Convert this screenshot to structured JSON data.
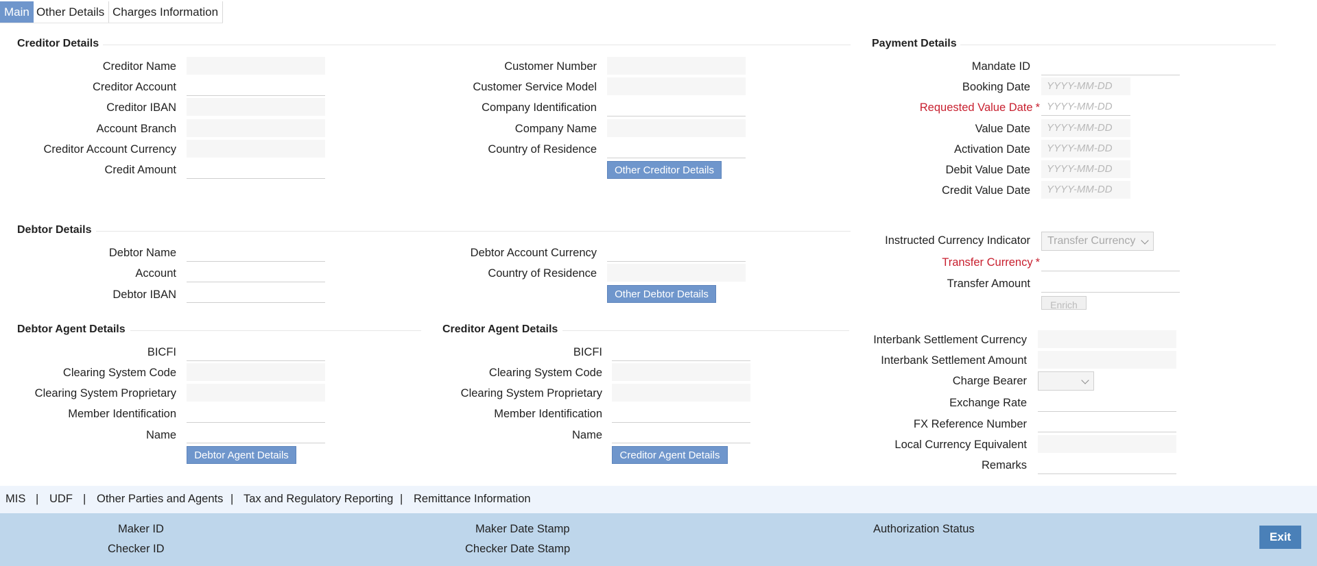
{
  "tabs": [
    "Main",
    "Other Details",
    "Charges Information"
  ],
  "creditor": {
    "title": "Creditor Details",
    "name": "Creditor Name",
    "account": "Creditor Account",
    "iban": "Creditor IBAN",
    "branch": "Account Branch",
    "currency": "Creditor Account Currency",
    "amount": "Credit Amount",
    "customer_number": "Customer Number",
    "service_model": "Customer Service Model",
    "company_id": "Company Identification",
    "company_name": "Company Name",
    "country": "Country of Residence",
    "other_button": "Other Creditor Details"
  },
  "debtor": {
    "title": "Debtor Details",
    "name": "Debtor Name",
    "account": "Account",
    "iban": "Debtor IBAN",
    "currency": "Debtor Account Currency",
    "country": "Country of Residence",
    "other_button": "Other Debtor Details"
  },
  "debtor_agent": {
    "title": "Debtor Agent Details",
    "bicfi": "BICFI",
    "clearing_code": "Clearing System Code",
    "clearing_prop": "Clearing System Proprietary",
    "member_id": "Member Identification",
    "name": "Name",
    "button": "Debtor Agent Details"
  },
  "creditor_agent": {
    "title": "Creditor Agent Details",
    "bicfi": "BICFI",
    "clearing_code": "Clearing System Code",
    "clearing_prop": "Clearing System Proprietary",
    "member_id": "Member Identification",
    "name": "Name",
    "button": "Creditor Agent Details"
  },
  "payment": {
    "title": "Payment Details",
    "mandate_id": "Mandate ID",
    "booking_date": "Booking Date",
    "requested_value_date": "Requested Value Date",
    "value_date": "Value Date",
    "activation_date": "Activation Date",
    "debit_value_date": "Debit Value Date",
    "credit_value_date": "Credit Value Date",
    "date_placeholder": "YYYY-MM-DD",
    "instructed_currency_indicator": "Instructed Currency Indicator",
    "instructed_currency_value": "Transfer Currency",
    "transfer_currency": "Transfer Currency",
    "transfer_amount": "Transfer Amount",
    "enrich_button": "Enrich",
    "settlement_currency": "Interbank Settlement Currency",
    "settlement_amount": "Interbank Settlement Amount",
    "charge_bearer": "Charge Bearer",
    "exchange_rate": "Exchange Rate",
    "fx_reference": "FX Reference Number",
    "local_equivalent": "Local Currency Equivalent",
    "remarks": "Remarks",
    "required_mark": "*"
  },
  "links": [
    "MIS",
    "UDF",
    "Other Parties and Agents",
    "Tax and Regulatory Reporting",
    "Remittance Information"
  ],
  "link_separator": "|",
  "footer": {
    "maker_id": "Maker ID",
    "checker_id": "Checker ID",
    "maker_date": "Maker Date Stamp",
    "checker_date": "Checker Date Stamp",
    "auth_status": "Authorization Status",
    "exit": "Exit"
  },
  "colors": {
    "accent": "#6f96cc",
    "required": "#c8202f",
    "footer_bg": "#bed6eb",
    "exit_bg": "#4a80b8"
  }
}
